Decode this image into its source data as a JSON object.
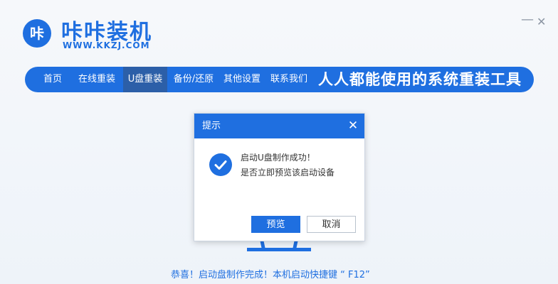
{
  "app": {
    "logo_mark": "咔",
    "title": "咔咔装机",
    "url": "WWW.KKZJ.COM"
  },
  "window": {
    "minimize_glyph": "—",
    "close_glyph": "✕"
  },
  "nav": {
    "items": [
      {
        "label": "首页",
        "active": false
      },
      {
        "label": "在线重装",
        "active": false
      },
      {
        "label": "U盘重装",
        "active": true
      },
      {
        "label": "备份/还原",
        "active": false
      },
      {
        "label": "其他设置",
        "active": false
      },
      {
        "label": "联系我们",
        "active": false
      }
    ],
    "slogan": "人人都能使用的系统重装工具"
  },
  "dialog": {
    "title": "提示",
    "close_glyph": "✕",
    "icon": "check-circle-icon",
    "message_line1": "启动U盘制作成功！",
    "message_line2": "是否立即预览该启动设备",
    "ok_label": "预览",
    "cancel_label": "取消"
  },
  "notice": {
    "line1": "恭喜！启动盘制作完成！本机启动快捷键 “ F12”",
    "line2": ""
  },
  "colors": {
    "accent": "#1f6fe0",
    "nav_active": "#2c5fa8",
    "background": "#f1f5fa"
  }
}
